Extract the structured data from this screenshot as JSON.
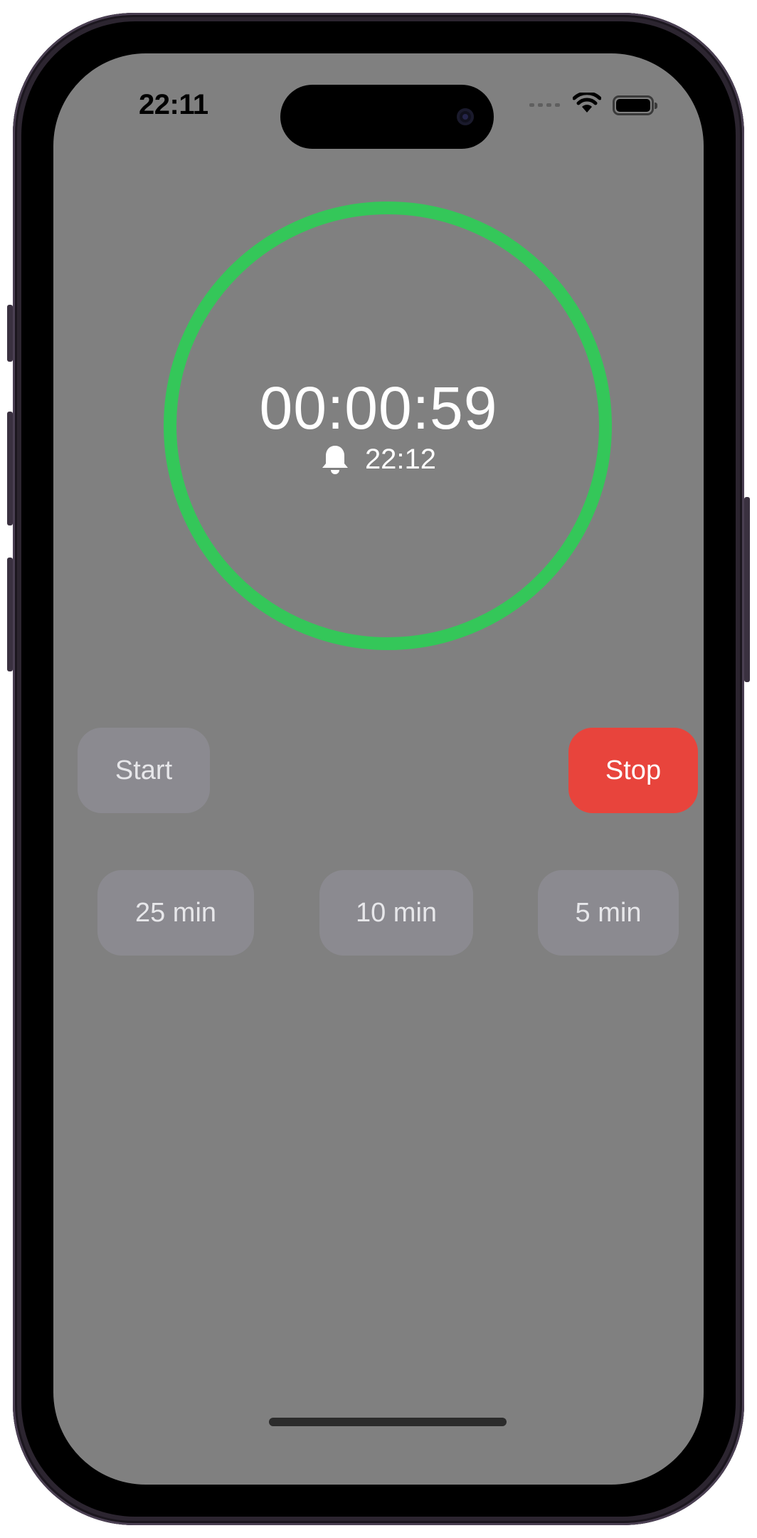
{
  "status_bar": {
    "time": "22:11",
    "icons": [
      "cellular-signal-icon",
      "wifi-icon",
      "battery-icon"
    ]
  },
  "timer": {
    "remaining": "00:00:59",
    "alarm_time": "22:12",
    "ring_color": "#34C759",
    "progress": 1.0
  },
  "controls": {
    "start_label": "Start",
    "stop_label": "Stop",
    "stop_color": "#E8443C"
  },
  "presets": [
    {
      "label": "25 min"
    },
    {
      "label": "10 min"
    },
    {
      "label": "5 min"
    }
  ]
}
